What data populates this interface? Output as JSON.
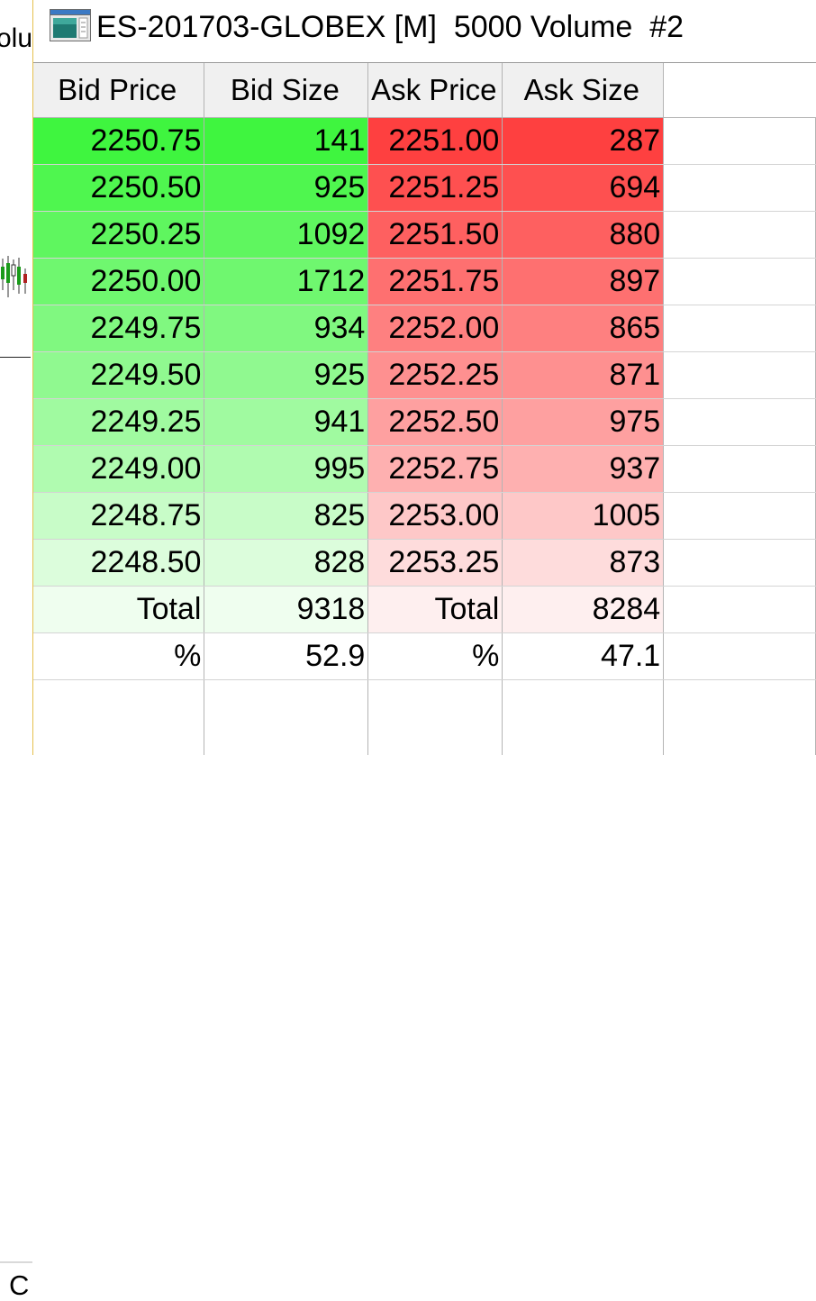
{
  "background_window": {
    "title_fragment": "olu",
    "bottom_fragment": "C"
  },
  "window": {
    "title": "ES-201703-GLOBEX [M]  5000 Volume  #2",
    "icon": "app-window-icon"
  },
  "table": {
    "headers": [
      "Bid Price",
      "Bid Size",
      "Ask Price",
      "Ask Size"
    ],
    "rows": [
      {
        "bid_price": "2250.75",
        "bid_size": "141",
        "ask_price": "2251.00",
        "ask_size": "287",
        "bid_color": "#3ff53f",
        "ask_color": "#fe4040"
      },
      {
        "bid_price": "2250.50",
        "bid_size": "925",
        "ask_price": "2251.25",
        "ask_size": "694",
        "bid_color": "#4ff64f",
        "ask_color": "#fe5050"
      },
      {
        "bid_price": "2250.25",
        "bid_size": "1092",
        "ask_price": "2251.50",
        "ask_size": "880",
        "bid_color": "#5ff65f",
        "ask_color": "#fe6060"
      },
      {
        "bid_price": "2250.00",
        "bid_size": "1712",
        "ask_price": "2251.75",
        "ask_size": "897",
        "bid_color": "#6ff76f",
        "ask_color": "#fe7070"
      },
      {
        "bid_price": "2249.75",
        "bid_size": "934",
        "ask_price": "2252.00",
        "ask_size": "865",
        "bid_color": "#80f880",
        "ask_color": "#fe8080"
      },
      {
        "bid_price": "2249.50",
        "bid_size": "925",
        "ask_price": "2252.25",
        "ask_size": "871",
        "bid_color": "#90f990",
        "ask_color": "#fe9090"
      },
      {
        "bid_price": "2249.25",
        "bid_size": "941",
        "ask_price": "2252.50",
        "ask_size": "975",
        "bid_color": "#a0faa0",
        "ask_color": "#fea0a0"
      },
      {
        "bid_price": "2249.00",
        "bid_size": "995",
        "ask_price": "2252.75",
        "ask_size": "937",
        "bid_color": "#b0fbb0",
        "ask_color": "#feb0b0"
      },
      {
        "bid_price": "2248.75",
        "bid_size": "825",
        "ask_price": "2253.00",
        "ask_size": "1005",
        "bid_color": "#c8fcc8",
        "ask_color": "#fec8c8"
      },
      {
        "bid_price": "2248.50",
        "bid_size": "828",
        "ask_price": "2253.25",
        "ask_size": "873",
        "bid_color": "#dcfddc",
        "ask_color": "#fedcdc"
      }
    ],
    "total": {
      "bid_label": "Total",
      "bid_value": "9318",
      "ask_label": "Total",
      "ask_value": "8284",
      "bid_color": "#effeef",
      "ask_color": "#feefef"
    },
    "percent": {
      "bid_label": "%",
      "bid_value": "52.9",
      "ask_label": "%",
      "ask_value": "47.1"
    }
  },
  "colors": {
    "header_bg": "#f0f0f0",
    "grid_line": "#b4b4b4",
    "window_border": "#e5c04d"
  }
}
